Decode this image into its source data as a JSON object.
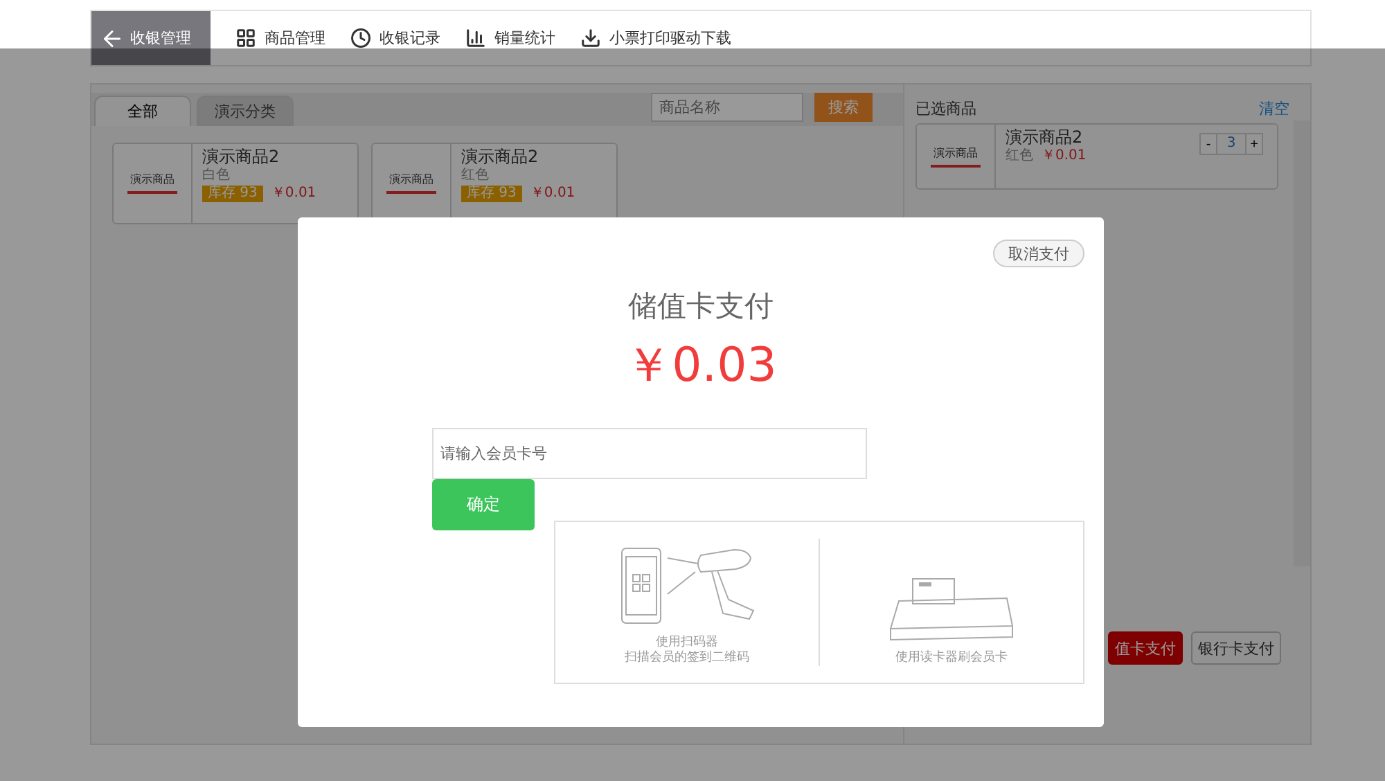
{
  "nav": {
    "back": "收银管理",
    "items": [
      {
        "label": "商品管理"
      },
      {
        "label": "收银记录"
      },
      {
        "label": "销量统计"
      },
      {
        "label": "小票打印驱动下载"
      }
    ]
  },
  "tabs": [
    {
      "label": "全部",
      "selected": true
    },
    {
      "label": "演示分类",
      "selected": false
    }
  ],
  "search": {
    "placeholder": "商品名称",
    "button": "搜索"
  },
  "products": [
    {
      "thumb": "演示商品",
      "name": "演示商品2",
      "variant": "白色",
      "stock": "库存 93",
      "price": "￥0.01"
    },
    {
      "thumb": "演示商品",
      "name": "演示商品2",
      "variant": "红色",
      "stock": "库存 93",
      "price": "￥0.01"
    }
  ],
  "cart": {
    "title": "已选商品",
    "clear": "清空",
    "items": [
      {
        "thumb": "演示商品",
        "name": "演示商品2",
        "variant": "红色",
        "price": "￥0.01",
        "minus": "-",
        "qty": "3",
        "plus": "+"
      }
    ]
  },
  "pay_buttons": [
    {
      "label": "值卡支付",
      "kind": "primary"
    },
    {
      "label": "银行卡支付",
      "kind": "default"
    }
  ],
  "modal": {
    "cancel": "取消支付",
    "title": "储值卡支付",
    "amount": "￥0.03",
    "card_field": {
      "placeholder": "请输入会员卡号"
    },
    "confirm": "确定",
    "methods": [
      {
        "kind": "scanner",
        "lines": [
          "使用扫码器",
          "扫描会员的签到二维码"
        ]
      },
      {
        "kind": "reader",
        "lines": [
          "使用读卡器刷会员卡"
        ]
      }
    ]
  }
}
